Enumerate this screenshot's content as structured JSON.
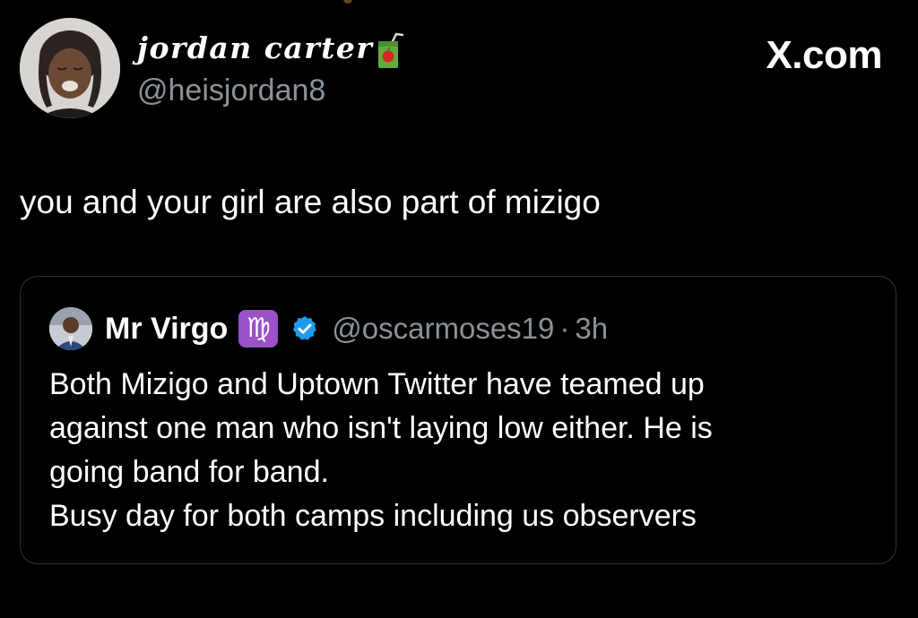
{
  "tweet": {
    "author_name": "jordan carter",
    "author_emoji": "juice-box-icon",
    "handle": "@heisjordan8",
    "text": "you and your girl are also part of mizigo"
  },
  "brand": {
    "label": "X.com"
  },
  "quoted_tweet": {
    "author_name": "Mr Virgo",
    "zodiac_badge": "♍",
    "verified_badge": "verified-check-icon",
    "handle": "@oscarmoses19",
    "separator": "·",
    "time": "3h",
    "lines": [
      "Both Mizigo and Uptown Twitter have teamed up",
      "against one man who isn't laying low either.  He is",
      "going band for band.",
      "Busy day for both camps including us observers"
    ]
  },
  "colors": {
    "background": "#000000",
    "primary_text": "#ffffff",
    "secondary_text": "#8b9298",
    "border": "#2f3336",
    "verified_blue": "#1d9bf0",
    "virgo_purple": "#9b51c8"
  }
}
